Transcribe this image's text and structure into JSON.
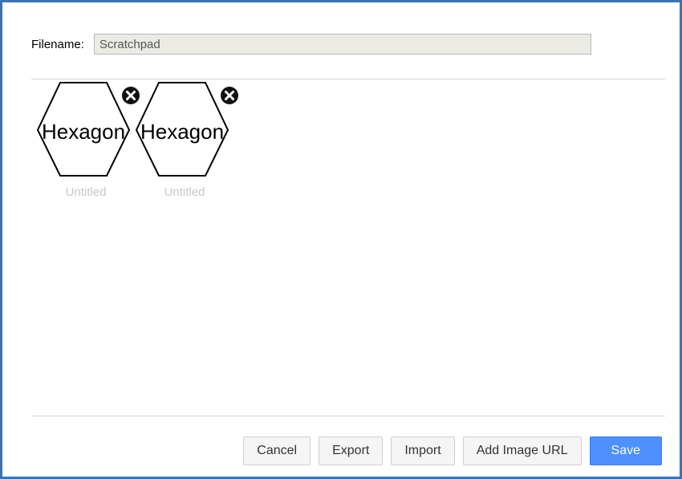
{
  "form": {
    "filename_label": "Filename:",
    "filename_value": "Scratchpad"
  },
  "library": {
    "items": [
      {
        "shape_text": "Hexagon",
        "title": "Untitled",
        "remove_icon": "close-circle-icon"
      },
      {
        "shape_text": "Hexagon",
        "title": "Untitled",
        "remove_icon": "close-circle-icon"
      }
    ]
  },
  "buttons": {
    "cancel": "Cancel",
    "export": "Export",
    "import": "Import",
    "add_image_url": "Add Image URL",
    "save": "Save"
  },
  "colors": {
    "dialog_border": "#3a73b8",
    "primary_button": "#4d90fe",
    "input_background": "#ebebe4"
  }
}
